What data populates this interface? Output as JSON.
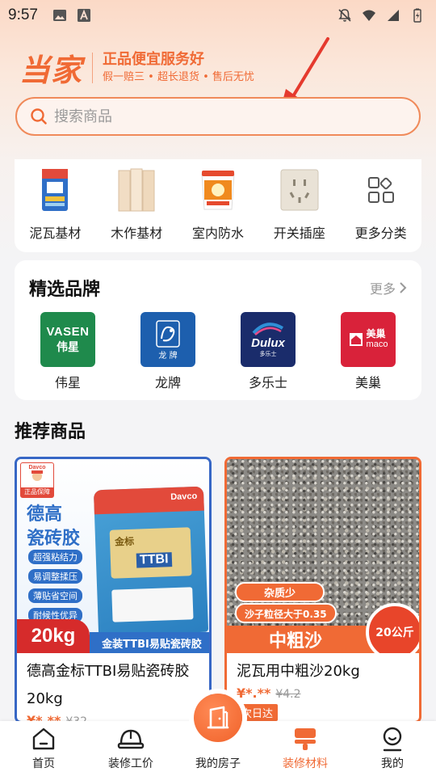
{
  "status_bar": {
    "time": "9:57",
    "icons": [
      "image-icon",
      "a-icon",
      "mute-icon",
      "wifi-icon",
      "signal-icon",
      "battery-icon"
    ]
  },
  "header": {
    "logo_text": "当家",
    "slogan_main": "正品便宜服务好",
    "slogan_sub": "假一赔三 • 超长退货 • 售后无忧"
  },
  "search": {
    "placeholder": "搜索商品"
  },
  "categories": [
    {
      "label": "泥瓦基材",
      "icon": "tile-adhesive-bag-icon"
    },
    {
      "label": "木作基材",
      "icon": "wood-board-icon"
    },
    {
      "label": "室内防水",
      "icon": "waterproof-bucket-icon"
    },
    {
      "label": "开关插座",
      "icon": "switch-socket-icon"
    },
    {
      "label": "更多分类",
      "icon": "grid-more-icon"
    }
  ],
  "brands": {
    "title": "精选品牌",
    "more_label": "更多",
    "items": [
      {
        "label": "伟星",
        "logo_line1": "VASEN",
        "logo_line2": "伟星",
        "color": "#1f8a4c"
      },
      {
        "label": "龙牌",
        "logo_line1": "",
        "logo_line2": "龙 牌",
        "color": "#1d5fae"
      },
      {
        "label": "多乐士",
        "logo_line1": "Dulux",
        "logo_line2": "多乐士",
        "color": "#1a2c6b"
      },
      {
        "label": "美巢",
        "logo_line1": "美巢",
        "logo_line2": "maco",
        "color": "#d9223a"
      }
    ]
  },
  "recommended": {
    "title": "推荐商品",
    "products": [
      {
        "name": "德高金标TTBI易贴瓷砖胶20kg",
        "price": "¥*.**",
        "orig_price": "¥32",
        "image": {
          "badge_top": "Davco",
          "badge": "正品保障",
          "brand_title_1": "德高",
          "brand_title_2": "瓷砖胶",
          "features": [
            "超强粘结力",
            "易调整揉压",
            "薄贴省空间",
            "耐候性优异"
          ],
          "weight": "20kg",
          "bottom_label": "金装TTBI易贴瓷砖胶",
          "bag_text": "TTBI",
          "bag_brand": "Davco",
          "bag_sub": "金标"
        }
      },
      {
        "name": "泥瓦用中粗沙20kg",
        "price": "¥*.**",
        "orig_price": "¥4.2",
        "tag": "次日达",
        "image": {
          "tag_1": "杂质少",
          "tag_2": "沙子粒径大于0.35",
          "bottom_label": "中粗沙",
          "weight": "20公斤"
        }
      }
    ]
  },
  "bottom_nav": [
    {
      "label": "首页",
      "icon": "home-icon",
      "active": false
    },
    {
      "label": "装修工价",
      "icon": "helmet-icon",
      "active": false
    },
    {
      "label": "我的房子",
      "icon": "house-door-icon",
      "active": false
    },
    {
      "label": "装修材料",
      "icon": "paint-roller-icon",
      "active": true
    },
    {
      "label": "我的",
      "icon": "user-icon",
      "active": false
    }
  ],
  "colors": {
    "brand": "#f06a35",
    "page_bg": "#f4f4f6",
    "annotation_arrow": "#e53a2e"
  }
}
